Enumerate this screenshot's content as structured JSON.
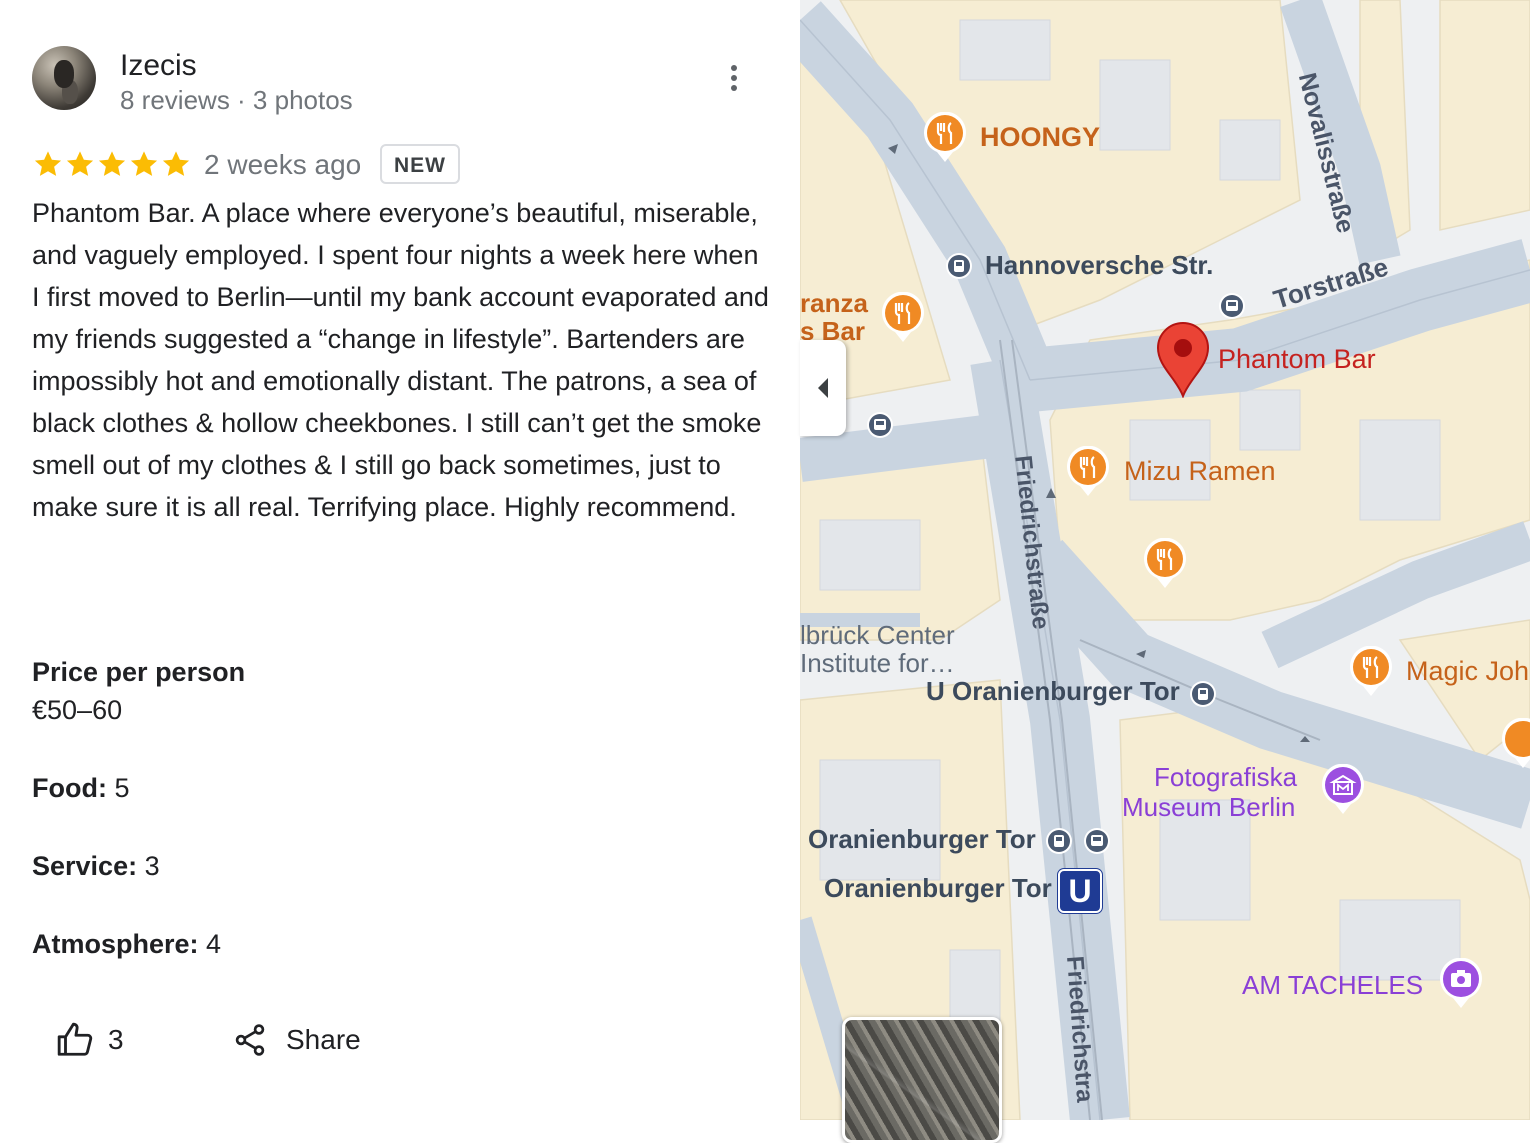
{
  "review": {
    "author": "Izecis",
    "author_meta": "8 reviews · 3 photos",
    "rating": 5,
    "time_ago": "2 weeks ago",
    "badge": "NEW",
    "text": "Phantom Bar. A place where everyone’s beautiful, miserable, and vaguely employed. I spent four nights a week here when I first moved to Berlin—until my bank account evaporated and my friends suggested a “change in lifestyle”. Bartenders are impossibly hot and emotionally distant. The patrons, a sea of black clothes & hollow cheekbones. I still can’t get the smoke smell out of my clothes & I still go back sometimes, just to make sure it is all real. Terrifying place. Highly recommend.",
    "price_label": "Price per person",
    "price_value": "€50–60",
    "food_label": "Food:",
    "food_value": "5",
    "service_label": "Service:",
    "service_value": "3",
    "atmosphere_label": "Atmosphere:",
    "atmosphere_value": "4",
    "likes": "3",
    "share_label": "Share"
  },
  "map": {
    "labels": {
      "hoongy": "HOONGY",
      "hannoversche": "Hannoversche Str.",
      "torstrasse": "Torstraße",
      "novalisstrasse": "Novalisstraße",
      "phantom_bar": "Phantom Bar",
      "mizu_ramen": "Mizu Ramen",
      "friedrichstrasse_1": "Friedrichstraße",
      "friedrichstrasse_2": "Friedrichstra",
      "ranza_1": "ranza",
      "ranza_2": "s Bar",
      "delbrueck_1": "lbrück Center",
      "delbrueck_2": "Institute for…",
      "u_oranienburger": "U Oranienburger Tor",
      "magic_johnson": "Magic Joh",
      "fotografiska_1": "Fotografiska",
      "fotografiska_2": "Museum Berlin",
      "oranienburger_tor_1": "Oranienburger Tor",
      "oranienburger_tor_2": "Oranienburger Tor",
      "ubahn_letter": "U",
      "am_tacheles": "AM TACHELES"
    },
    "colors": {
      "restaurant": "#f08a24",
      "museum": "#9c4fe0",
      "pin": "#ea4335",
      "transit": "#4a5a72"
    }
  }
}
